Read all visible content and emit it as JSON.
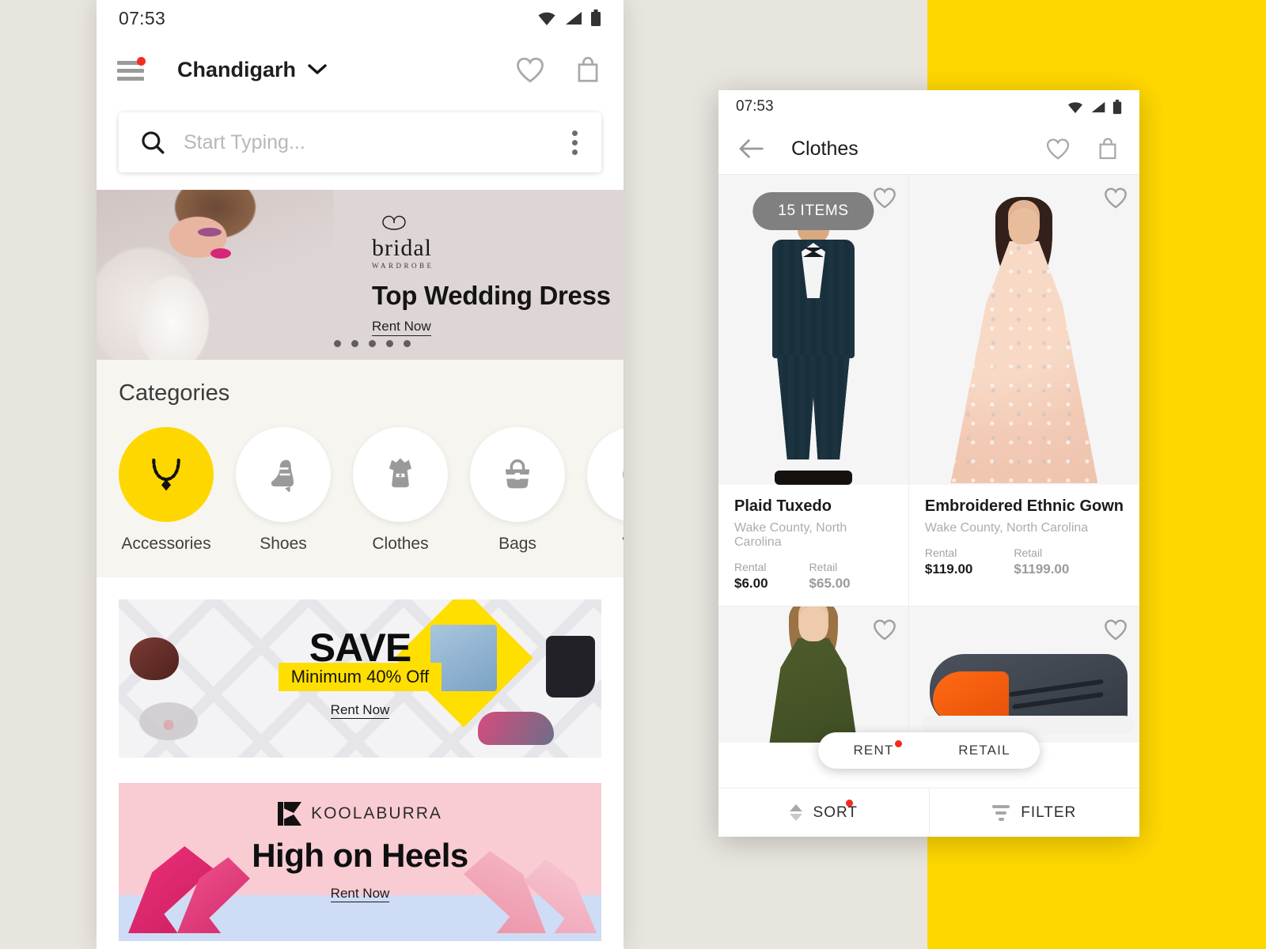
{
  "theme": {
    "accent_yellow": "#FFD700",
    "backdrop_beige": "#E8E4DE",
    "badge_red": "#F42C20"
  },
  "home_screen": {
    "status": {
      "time": "07:53",
      "icons": [
        "wifi-icon",
        "signal-icon",
        "battery-icon"
      ]
    },
    "appbar": {
      "menu_icon": "hamburger-menu-icon",
      "has_notification": true,
      "city": "Chandigarh",
      "chevron_icon": "chevron-down-icon",
      "wishlist_icon": "heart-icon",
      "bag_icon": "shopping-bag-icon"
    },
    "search": {
      "placeholder": "Start Typing...",
      "value": "",
      "icon": "search-icon",
      "overflow_icon": "more-vertical-icon"
    },
    "hero": {
      "brand": "bridal",
      "brand_sub": "WARDROBE",
      "title": "Top Wedding Dress",
      "cta": "Rent Now",
      "dot_count": 5
    },
    "categories": {
      "heading": "Categories",
      "items": [
        {
          "label": "Accessories",
          "icon": "necklace-icon",
          "active": true
        },
        {
          "label": "Shoes",
          "icon": "high-heel-icon",
          "active": false
        },
        {
          "label": "Clothes",
          "icon": "dress-icon",
          "active": false
        },
        {
          "label": "Bags",
          "icon": "handbag-icon",
          "active": false
        },
        {
          "label": "Wa",
          "icon": "watch-icon",
          "active": false
        }
      ]
    },
    "promos": [
      {
        "headline": "SAVE",
        "subline": "Minimum 40% Off",
        "cta": "Rent Now"
      },
      {
        "brand": "KOOLABURRA",
        "headline": "High on Heels",
        "cta": "Rent Now"
      }
    ]
  },
  "listing_screen": {
    "status": {
      "time": "07:53",
      "icons": [
        "wifi-icon",
        "signal-icon",
        "battery-icon"
      ]
    },
    "appbar": {
      "back_icon": "arrow-left-icon",
      "title": "Clothes",
      "wishlist_icon": "heart-icon",
      "bag_icon": "shopping-bag-icon"
    },
    "items_badge": "15 ITEMS",
    "price_labels": {
      "rental": "Rental",
      "retail": "Retail"
    },
    "products": [
      {
        "name": "Plaid Tuxedo",
        "location": "Wake County, North Carolina",
        "rental": "$6.00",
        "retail": "$65.00"
      },
      {
        "name": "Embroidered Ethnic Gown",
        "location": "Wake County, North Carolina",
        "rental": "$119.00",
        "retail": "$1199.00"
      }
    ],
    "toggle": {
      "rent": "RENT",
      "retail": "RETAIL",
      "rent_has_badge": true
    },
    "bottombar": {
      "sort": "SORT",
      "sort_icon": "sort-arrows-icon",
      "sort_has_badge": true,
      "filter": "FILTER",
      "filter_icon": "filter-funnel-icon"
    }
  }
}
